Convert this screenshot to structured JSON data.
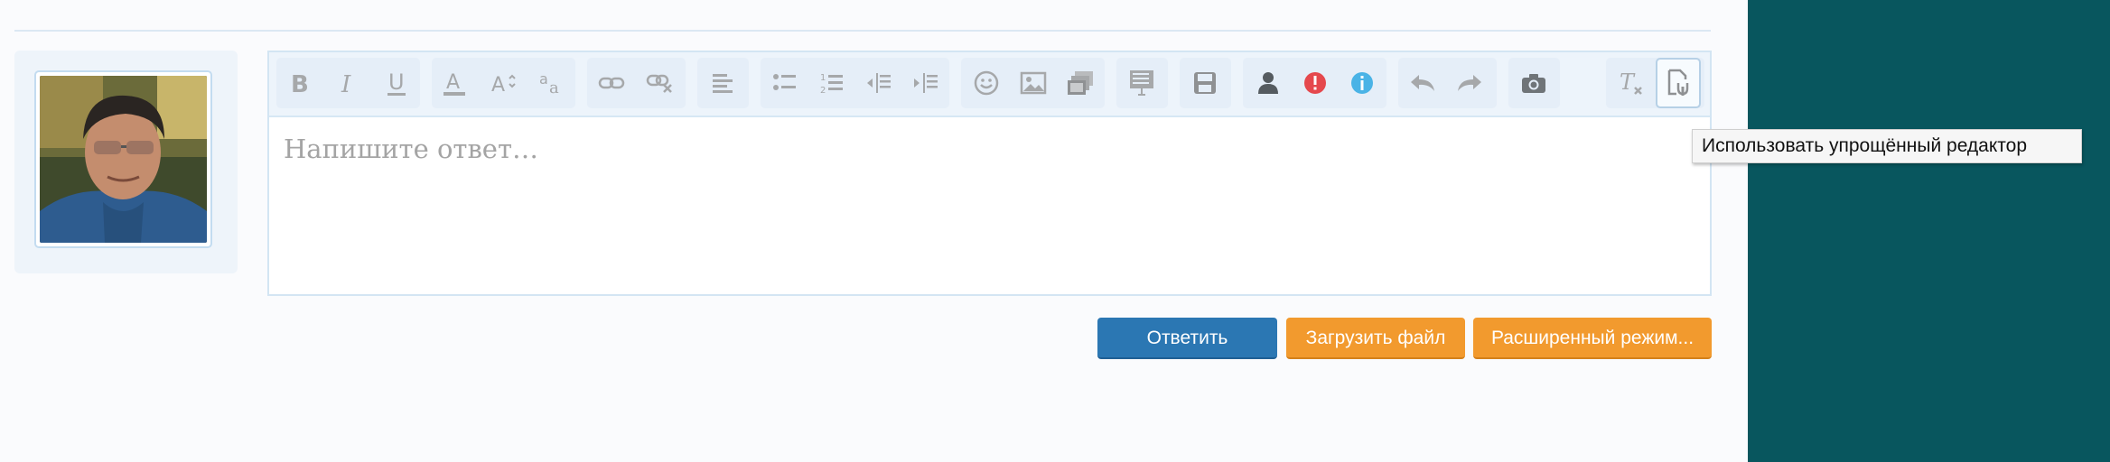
{
  "editor": {
    "placeholder": "Напишите ответ…",
    "toolbar": {
      "buttons": [
        {
          "name": "bold",
          "icon": "bold-icon"
        },
        {
          "name": "italic",
          "icon": "italic-icon"
        },
        {
          "name": "underline",
          "icon": "underline-icon"
        },
        {
          "name": "text-color",
          "icon": "text-color-icon"
        },
        {
          "name": "font-size",
          "icon": "font-size-icon"
        },
        {
          "name": "font-family",
          "icon": "font-family-icon"
        },
        {
          "name": "link",
          "icon": "link-icon"
        },
        {
          "name": "unlink",
          "icon": "unlink-icon"
        },
        {
          "name": "align",
          "icon": "align-left-icon"
        },
        {
          "name": "bulleted-list",
          "icon": "bulleted-list-icon"
        },
        {
          "name": "numbered-list",
          "icon": "numbered-list-icon"
        },
        {
          "name": "outdent",
          "icon": "outdent-icon"
        },
        {
          "name": "indent",
          "icon": "indent-icon"
        },
        {
          "name": "smilies",
          "icon": "smile-icon"
        },
        {
          "name": "image",
          "icon": "image-icon"
        },
        {
          "name": "media",
          "icon": "media-icon"
        },
        {
          "name": "insert",
          "icon": "insert-icon"
        },
        {
          "name": "drafts",
          "icon": "save-icon"
        },
        {
          "name": "user",
          "icon": "user-icon"
        },
        {
          "name": "warning",
          "icon": "warning-icon"
        },
        {
          "name": "info",
          "icon": "info-icon"
        },
        {
          "name": "undo",
          "icon": "undo-icon"
        },
        {
          "name": "redo",
          "icon": "redo-icon"
        },
        {
          "name": "camera",
          "icon": "camera-icon"
        },
        {
          "name": "remove-format",
          "icon": "remove-format-icon"
        },
        {
          "name": "simple-editor",
          "icon": "simple-editor-icon"
        }
      ]
    }
  },
  "tooltip": {
    "text": "Использовать упрощённый редактор"
  },
  "actions": {
    "reply_label": "Ответить",
    "upload_label": "Загрузить файл",
    "advanced_label": "Расширенный режим..."
  },
  "colors": {
    "accent_blue": "#2b77b3",
    "accent_orange": "#f29a2e",
    "sidebar_teal": "#08565e",
    "warning_red": "#e5484d",
    "info_blue": "#4ab3e6"
  }
}
